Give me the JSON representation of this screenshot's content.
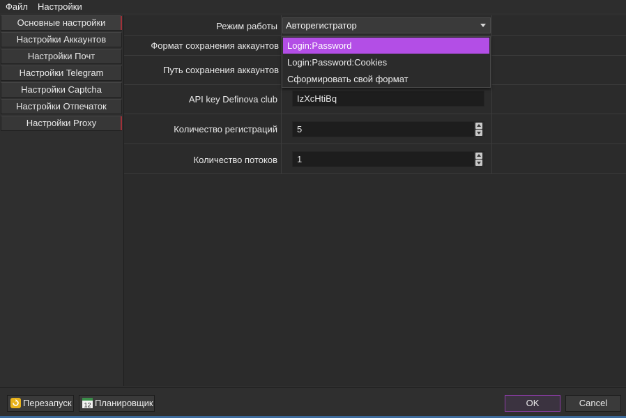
{
  "menu": {
    "file": "Файл",
    "settings": "Настройки"
  },
  "sidebar": {
    "items": [
      {
        "label": "Основные настройки"
      },
      {
        "label": "Настройки Аккаунтов"
      },
      {
        "label": "Настройки Почт"
      },
      {
        "label": "Настройки Telegram"
      },
      {
        "label": "Настройки Captcha"
      },
      {
        "label": "Настройки Отпечаток"
      },
      {
        "label": "Настройки Proxy"
      }
    ]
  },
  "form": {
    "mode_label": "Режим работы",
    "mode_value": "Авторегистратор",
    "format_label": "Формат сохранения аккаунтов",
    "path_label": "Путь сохранения аккаунтов",
    "api_label": "API key Definova club",
    "api_value": "IzXcHtiBq",
    "reg_count_label": "Количество регистраций",
    "reg_count_value": "5",
    "threads_label": "Количество потоков",
    "threads_value": "1"
  },
  "dropdown": {
    "options": [
      {
        "label": "Login:Password",
        "selected": true
      },
      {
        "label": "Login:Password:Cookies",
        "selected": false
      },
      {
        "label": "Сформировать свой формат",
        "selected": false
      }
    ],
    "highlight_color": "#b34ee6"
  },
  "footer": {
    "restart_label": "Перезапуск",
    "restart_icon": "restart-icon",
    "scheduler_label": "Планировщик",
    "scheduler_icon": "calendar-icon",
    "calendar_day": "12",
    "ok_label": "OK",
    "cancel_label": "Cancel"
  }
}
